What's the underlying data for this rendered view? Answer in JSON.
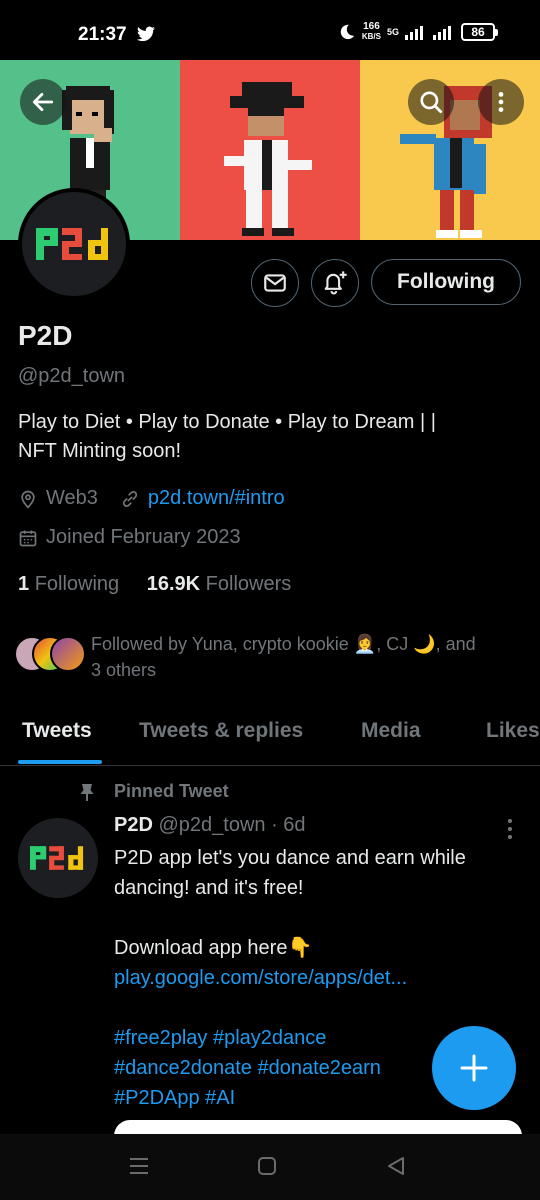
{
  "status_bar": {
    "time": "21:37",
    "speed": "166",
    "speed_unit": "KB/S",
    "network": "5G",
    "battery": "86"
  },
  "header": {
    "icons": [
      "back-arrow-icon",
      "search-icon",
      "more-vertical-icon"
    ],
    "banner_colors": [
      "#55c18a",
      "#ee4f44",
      "#f8c94d"
    ]
  },
  "profile": {
    "name": "P2D",
    "handle": "@p2d_town",
    "bio_line1": "Play to Diet • Play to Donate • Play to Dream | |",
    "bio_line2": "NFT Minting soon!",
    "location": "Web3",
    "website": "p2d.town/#intro",
    "joined": "Joined February 2023",
    "following_count": "1",
    "following_label": "Following",
    "followers_count": "16.9K",
    "followers_label": "Followers",
    "follow_button": "Following",
    "followed_by_line1": "Followed by Yuna, crypto kookie 👩‍💼, CJ 🌙, and",
    "followed_by_line2": "3 others"
  },
  "tabs": [
    "Tweets",
    "Tweets & replies",
    "Media",
    "Likes"
  ],
  "pinned_tweet": {
    "pinned_label": "Pinned Tweet",
    "author_name": "P2D",
    "author_handle": "@p2d_town",
    "time": "· 6d",
    "line1": "P2D app let's you dance and earn while",
    "line2": "dancing! and it's free!",
    "line3": "Download app here👇",
    "link": "play.google.com/store/apps/det...",
    "hashtags_line1": "#free2play #play2dance",
    "hashtags_line2": "#dance2donate #donate2earn",
    "hashtags_line3": "#P2DApp #AI"
  },
  "fab": {
    "label": "+"
  },
  "colors": {
    "accent": "#1d9bf0",
    "muted": "#71767b",
    "text": "#e7e9ea"
  }
}
